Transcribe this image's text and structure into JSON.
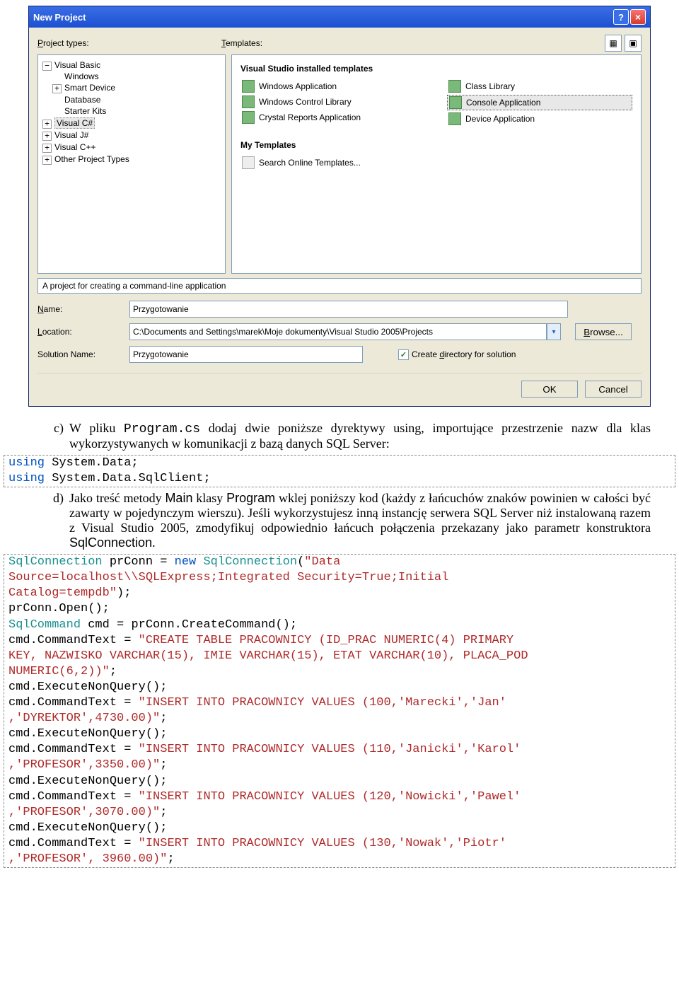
{
  "dialog": {
    "title": "New Project",
    "labels": {
      "projectTypes": "Project types:",
      "templates": "Templates:"
    },
    "projectTypes": {
      "vb": {
        "label": "Visual Basic",
        "expanded": true,
        "children": [
          "Windows",
          "Smart Device",
          "Database",
          "Starter Kits"
        ]
      },
      "vcs": "Visual C#",
      "vjs": "Visual J#",
      "vcpp": "Visual C++",
      "other": "Other Project Types"
    },
    "templates": {
      "heading1": "Visual Studio installed templates",
      "col1": [
        "Windows Application",
        "Windows Control Library",
        "Crystal Reports Application"
      ],
      "col2": [
        "Class Library",
        "Console Application",
        "Device Application"
      ],
      "heading2": "My Templates",
      "search": "Search Online Templates..."
    },
    "description": "A project for creating a command-line application",
    "form": {
      "nameLabel": "Name:",
      "nameValue": "Przygotowanie",
      "locationLabel": "Location:",
      "locationValue": "C:\\Documents and Settings\\marek\\Moje dokumenty\\Visual Studio 2005\\Projects",
      "browse": "Browse...",
      "solutionLabel": "Solution Name:",
      "solutionValue": "Przygotowanie",
      "createDir": "Create directory for solution"
    },
    "buttons": {
      "ok": "OK",
      "cancel": "Cancel"
    }
  },
  "doc": {
    "c_bullet": "c)",
    "c_text1": "W pliku ",
    "c_code": "Program.cs",
    "c_text2": " dodaj dwie poniższe dyrektywy using, importujące przestrzenie nazw dla klas wykorzystywanych w komunikacji z bazą danych SQL Server:",
    "d_bullet": "d)",
    "d_text1": "Jako treść metody ",
    "d_m1": "Main",
    "d_text2": " klasy ",
    "d_m2": "Program",
    "d_text3": " wklej poniższy kod (każdy z łańcuchów znaków powinien w całości być zawarty w pojedynczym wierszu). Jeśli wykorzystujesz inną instancję serwera SQL Server niż instalowaną razem z Visual Studio 2005, zmodyfikuj odpowiednio łańcuch połączenia przekazany jako parametr konstruktora ",
    "d_m3": "SqlConnection",
    "d_text4": "."
  },
  "code1": {
    "l1a": "using",
    "l1b": " System.Data;",
    "l2a": "using",
    "l2b": " System.Data.SqlClient;"
  },
  "code2": {
    "l1": {
      "t1": "SqlConnection",
      "p": " prConn = ",
      "t2": "new",
      "sp": " ",
      "t3": "SqlConnection",
      "op": "(",
      "s": "\"Data "
    },
    "l2": {
      "s": "Source=localhost\\\\SQLExpress;Integrated Security=True;Initial "
    },
    "l3": {
      "s": "Catalog=tempdb\"",
      "p": ");"
    },
    "l4": "prConn.Open();",
    "l5": {
      "t": "SqlCommand",
      "p": " cmd = prConn.CreateCommand();"
    },
    "l6": {
      "p": "cmd.CommandText = ",
      "s": "\"CREATE TABLE PRACOWNICY (ID_PRAC NUMERIC(4) PRIMARY "
    },
    "l7": {
      "s": "KEY, NAZWISKO VARCHAR(15), IMIE VARCHAR(15), ETAT VARCHAR(10), PLACA_POD "
    },
    "l8": {
      "s": "NUMERIC(6,2))\"",
      "p": ";"
    },
    "l9": "cmd.ExecuteNonQuery();",
    "l10": {
      "p": "cmd.CommandText = ",
      "s": "\"INSERT INTO PRACOWNICY VALUES (100,'Marecki','Jan'"
    },
    "l11": {
      "s": ",'DYREKTOR',4730.00)\"",
      "p": ";"
    },
    "l12": "cmd.ExecuteNonQuery();",
    "l13": {
      "p": "cmd.CommandText = ",
      "s": "\"INSERT INTO PRACOWNICY VALUES (110,'Janicki','Karol'"
    },
    "l14": {
      "s": ",'PROFESOR',3350.00)\"",
      "p": ";"
    },
    "l15": "cmd.ExecuteNonQuery();",
    "l16": {
      "p": "cmd.CommandText = ",
      "s": "\"INSERT INTO PRACOWNICY VALUES (120,'Nowicki','Pawel'"
    },
    "l17": {
      "s": ",'PROFESOR',3070.00)\"",
      "p": ";"
    },
    "l18": "cmd.ExecuteNonQuery();",
    "l19": {
      "p": "cmd.CommandText = ",
      "s": "\"INSERT INTO PRACOWNICY VALUES (130,'Nowak','Piotr'"
    },
    "l20": {
      "s": ",'PROFESOR', 3960.00)\"",
      "p": ";"
    }
  }
}
